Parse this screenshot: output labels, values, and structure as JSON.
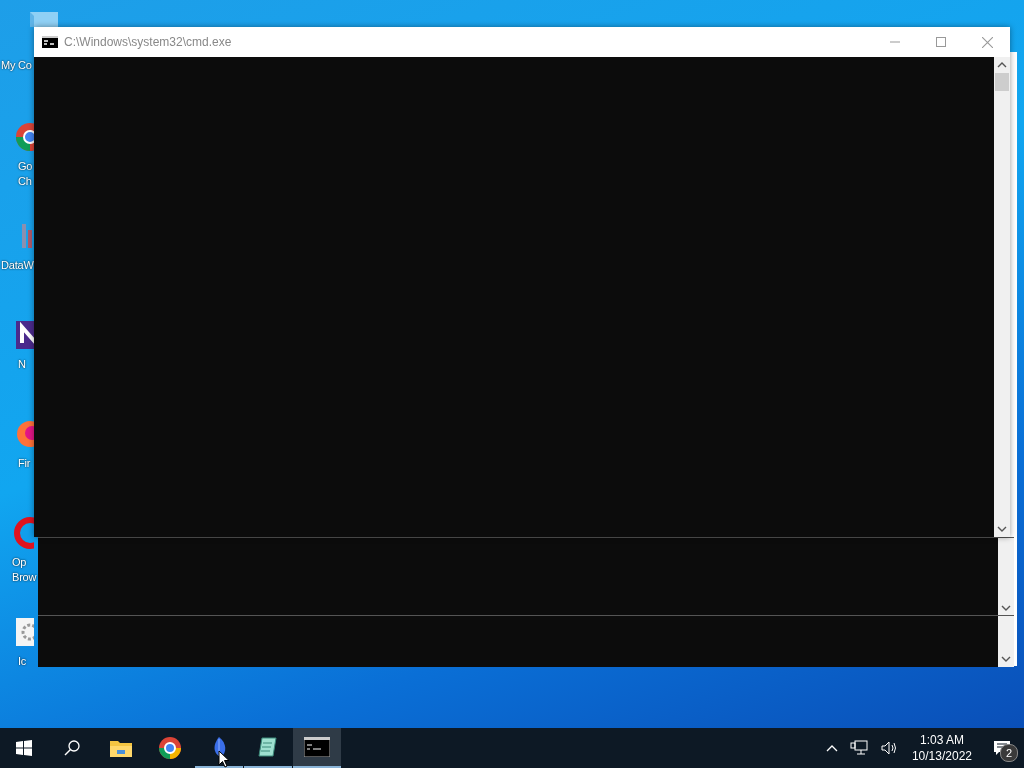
{
  "desktop_icons": [
    {
      "kind": "computer",
      "lines": [
        "My Co"
      ]
    },
    {
      "kind": "chrome",
      "lines": [
        "Go",
        "Ch"
      ]
    },
    {
      "kind": "chart",
      "lines": [
        "DataW"
      ]
    },
    {
      "kind": "purple",
      "lines": [
        "N"
      ]
    },
    {
      "kind": "firefox",
      "lines": [
        "Fir"
      ]
    },
    {
      "kind": "opera",
      "lines": [
        "Op",
        "Brow"
      ]
    },
    {
      "kind": "gear",
      "lines": [
        "Ic"
      ]
    }
  ],
  "window": {
    "title": "C:\\Windows\\system32\\cmd.exe"
  },
  "taskbar": {
    "apps": [
      {
        "kind": "explorer",
        "running": false,
        "active": false
      },
      {
        "kind": "chrome",
        "running": false,
        "active": false
      },
      {
        "kind": "feather",
        "running": true,
        "active": false
      },
      {
        "kind": "notepad",
        "running": true,
        "active": false
      },
      {
        "kind": "cmd",
        "running": true,
        "active": true
      }
    ],
    "time": "1:03 AM",
    "date": "10/13/2022",
    "notifications": "2"
  }
}
